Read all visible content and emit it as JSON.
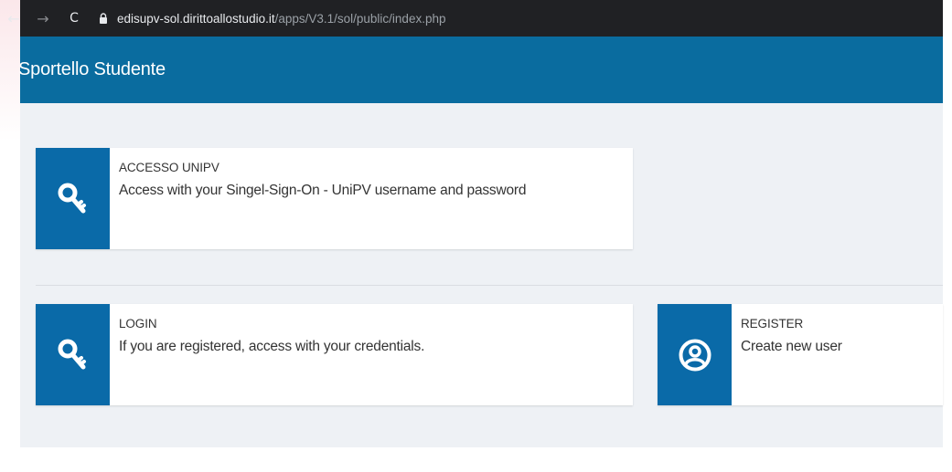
{
  "browser": {
    "url_host": "edisupv-sol.dirittoallostudio.it",
    "url_path": "/apps/V3.1/sol/public/index.php",
    "back_glyph": "←",
    "forward_glyph": "→",
    "reload_glyph": "C",
    "lock_icon": "lock-icon"
  },
  "header": {
    "title": "Sportello Studente",
    "color": "#0a6c9f"
  },
  "cards": {
    "unipv": {
      "title": "ACCESSO UNIPV",
      "description": "Access with your Singel-Sign-On - UniPV username and password",
      "icon": "key-icon"
    },
    "login": {
      "title": "LOGIN",
      "description": "If you are registered, access with your credentials.",
      "icon": "key-icon"
    },
    "register": {
      "title": "REGISTER",
      "description": "Create new user",
      "icon": "user-icon"
    }
  },
  "colors": {
    "accent": "#0a6aa8",
    "background": "#eef1f5"
  }
}
